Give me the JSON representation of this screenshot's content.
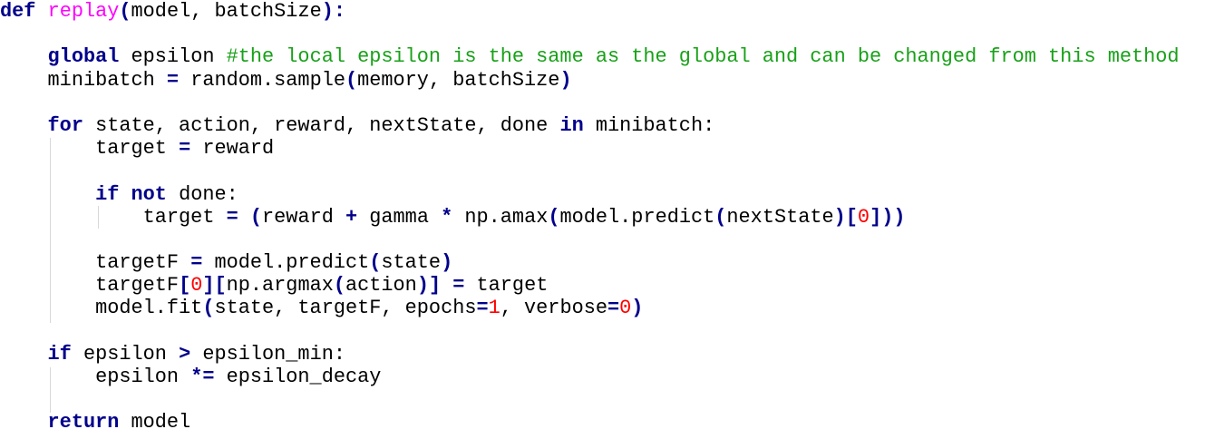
{
  "colors": {
    "keyword": "#00008b",
    "function_name": "#ff00ff",
    "comment": "#18a118",
    "number": "#ff0000",
    "text": "#000000",
    "background": "#ffffff"
  },
  "code_lines": [
    [
      {
        "t": "def",
        "c": "kw"
      },
      {
        "t": " "
      },
      {
        "t": "replay",
        "c": "fn"
      },
      {
        "t": "(",
        "c": "op"
      },
      {
        "t": "model, batchSize"
      },
      {
        "t": "):",
        "c": "op"
      }
    ],
    [],
    [
      {
        "t": "    "
      },
      {
        "t": "global",
        "c": "kw"
      },
      {
        "t": " epsilon "
      },
      {
        "t": "#the local epsilon is the same as the global and can be changed from this method",
        "c": "cm"
      }
    ],
    [
      {
        "t": "    minibatch "
      },
      {
        "t": "=",
        "c": "op"
      },
      {
        "t": " random.sample"
      },
      {
        "t": "(",
        "c": "op"
      },
      {
        "t": "memory, batchSize"
      },
      {
        "t": ")",
        "c": "op"
      }
    ],
    [],
    [
      {
        "t": "    "
      },
      {
        "t": "for",
        "c": "kw"
      },
      {
        "t": " state, action, reward, nextState, done "
      },
      {
        "t": "in",
        "c": "kw"
      },
      {
        "t": " minibatch:"
      }
    ],
    [
      {
        "t": "        target "
      },
      {
        "t": "=",
        "c": "op"
      },
      {
        "t": " reward"
      }
    ],
    [],
    [
      {
        "t": "        "
      },
      {
        "t": "if",
        "c": "kw"
      },
      {
        "t": " "
      },
      {
        "t": "not",
        "c": "kw"
      },
      {
        "t": " done:"
      }
    ],
    [
      {
        "t": "            target "
      },
      {
        "t": "=",
        "c": "op"
      },
      {
        "t": " "
      },
      {
        "t": "(",
        "c": "op"
      },
      {
        "t": "reward "
      },
      {
        "t": "+",
        "c": "op"
      },
      {
        "t": " gamma "
      },
      {
        "t": "*",
        "c": "op"
      },
      {
        "t": " np.amax"
      },
      {
        "t": "(",
        "c": "op"
      },
      {
        "t": "model.predict"
      },
      {
        "t": "(",
        "c": "op"
      },
      {
        "t": "nextState"
      },
      {
        "t": ")[",
        "c": "op"
      },
      {
        "t": "0",
        "c": "nm"
      },
      {
        "t": "]))",
        "c": "op"
      }
    ],
    [],
    [
      {
        "t": "        targetF "
      },
      {
        "t": "=",
        "c": "op"
      },
      {
        "t": " model.predict"
      },
      {
        "t": "(",
        "c": "op"
      },
      {
        "t": "state"
      },
      {
        "t": ")",
        "c": "op"
      }
    ],
    [
      {
        "t": "        targetF"
      },
      {
        "t": "[",
        "c": "op"
      },
      {
        "t": "0",
        "c": "nm"
      },
      {
        "t": "][",
        "c": "op"
      },
      {
        "t": "np.argmax"
      },
      {
        "t": "(",
        "c": "op"
      },
      {
        "t": "action"
      },
      {
        "t": ")]",
        "c": "op"
      },
      {
        "t": " "
      },
      {
        "t": "=",
        "c": "op"
      },
      {
        "t": " target"
      }
    ],
    [
      {
        "t": "        model.fit"
      },
      {
        "t": "(",
        "c": "op"
      },
      {
        "t": "state, targetF, epochs"
      },
      {
        "t": "=",
        "c": "op"
      },
      {
        "t": "1",
        "c": "nm"
      },
      {
        "t": ", verbose"
      },
      {
        "t": "=",
        "c": "op"
      },
      {
        "t": "0",
        "c": "nm"
      },
      {
        "t": ")",
        "c": "op"
      }
    ],
    [],
    [
      {
        "t": "    "
      },
      {
        "t": "if",
        "c": "kw"
      },
      {
        "t": " epsilon "
      },
      {
        "t": ">",
        "c": "op"
      },
      {
        "t": " epsilon_min:"
      }
    ],
    [
      {
        "t": "        epsilon "
      },
      {
        "t": "*=",
        "c": "op"
      },
      {
        "t": " epsilon_decay"
      }
    ],
    [],
    [
      {
        "t": "    "
      },
      {
        "t": "return",
        "c": "kw"
      },
      {
        "t": " model"
      }
    ]
  ]
}
